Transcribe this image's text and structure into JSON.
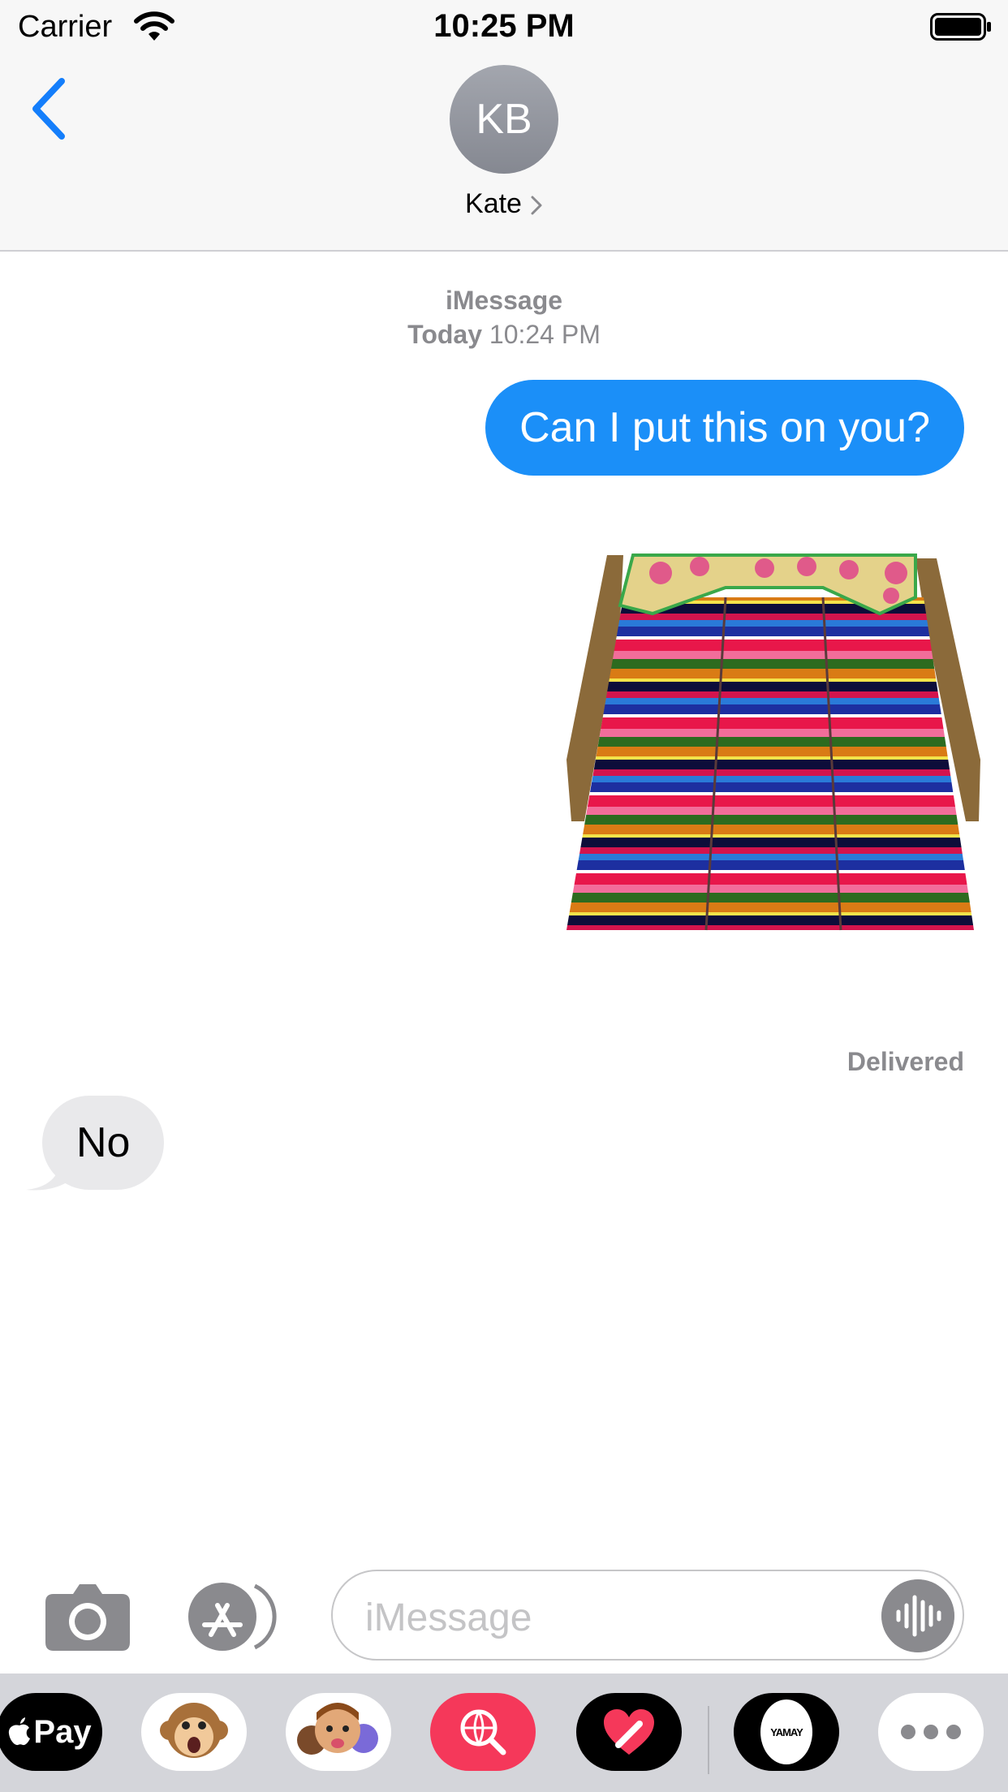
{
  "status_bar": {
    "carrier": "Carrier",
    "time": "10:25 PM"
  },
  "header": {
    "avatar_initials": "KB",
    "contact_name": "Kate"
  },
  "conversation": {
    "service": "iMessage",
    "timestamp_day": "Today",
    "timestamp_time": "10:24 PM",
    "messages": [
      {
        "direction": "outgoing",
        "text": "Can I put this on you?"
      },
      {
        "direction": "outgoing",
        "type": "sticker",
        "description": "striped apron"
      },
      {
        "direction": "incoming",
        "text": "No"
      }
    ],
    "delivery_status": "Delivered"
  },
  "input_bar": {
    "placeholder": "iMessage"
  },
  "app_drawer": {
    "apps": [
      {
        "name": "Apple Pay",
        "label": "Pay"
      },
      {
        "name": "Animoji"
      },
      {
        "name": "Memoji Stickers"
      },
      {
        "name": "Images Search"
      },
      {
        "name": "Digital Touch"
      },
      {
        "name": "YAMAY",
        "label": "YAMAY"
      },
      {
        "name": "More"
      }
    ]
  },
  "colors": {
    "outgoing_bubble": "#1b8ff8",
    "incoming_bubble": "#e9e9eb",
    "accent": "#147efb",
    "meta_text": "#8a8a8e"
  }
}
